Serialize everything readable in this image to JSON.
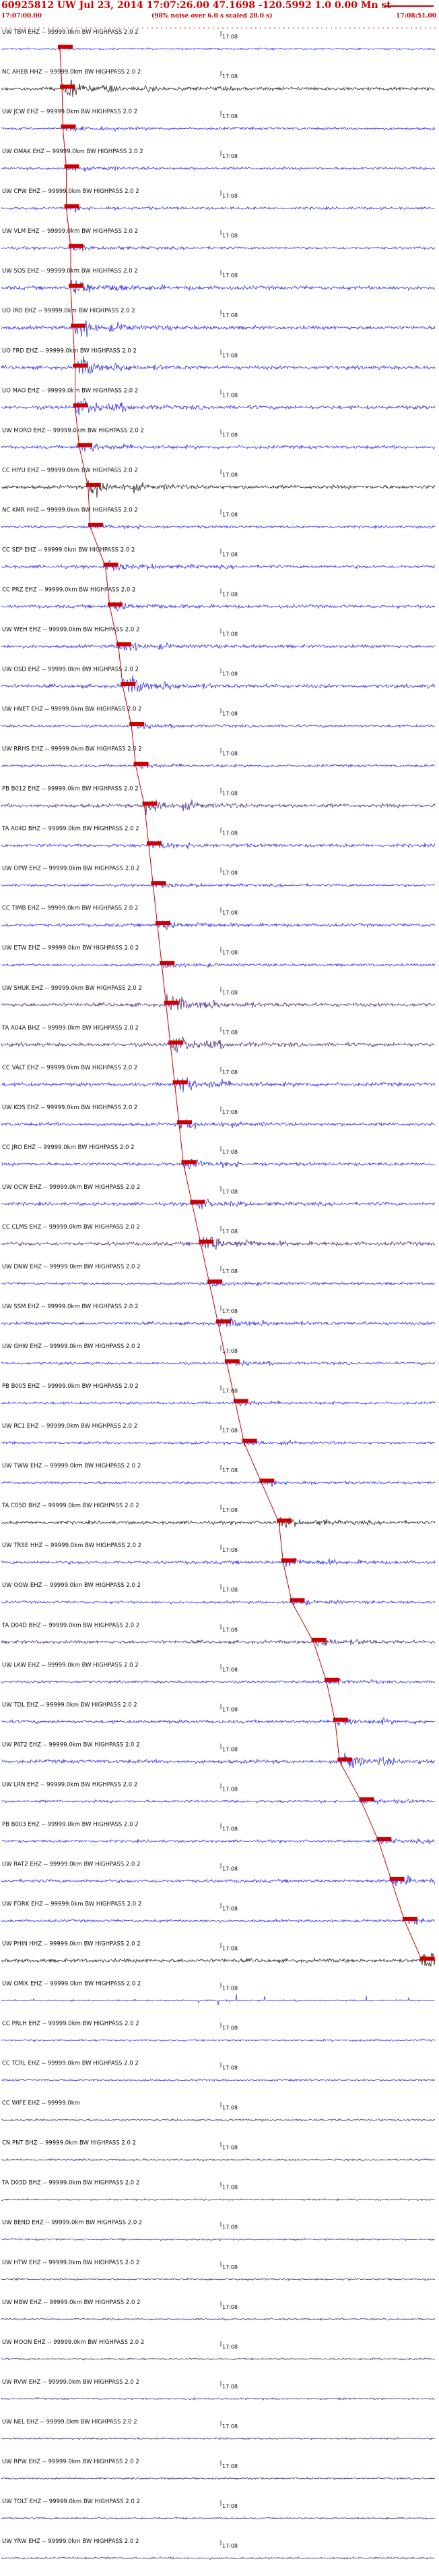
{
  "header": {
    "title": "60925812 UW Jul 23, 2014 17:07:26.00   47.1698 -120.5992  1.0 0.00 Mn st",
    "start_time": "17:07:00.00",
    "note": "(98% noise over 6.0 s scaled 20.0 s)",
    "end_time": "17:08:51.00"
  },
  "chart_data": {
    "type": "line",
    "title": "60925812 UW Jul 23, 2014 17:07:26.00   47.1698 -120.5992  1.0 0.00 Mn st",
    "minute_label": "17:08",
    "pick_color": "#cc0000",
    "trace_colors": [
      "#1a1aee",
      "#111111",
      "#3a1a7a"
    ],
    "tick_color": "#cc0000",
    "traces": [
      {
        "label": "UW TBM EHZ -- 99999.0km BW  HIGHPASS  2.0  2",
        "color": "blue",
        "pick_frac": 0.135,
        "burst": "none"
      },
      {
        "label": "NC AHEB HHZ -- 99999.0km BW  HIGHPASS  2.0  2",
        "color": "black",
        "pick_frac": 0.14,
        "burst": "strong"
      },
      {
        "label": "UW JCW EHZ -- 99999.0km BW  HIGHPASS  2.0  2",
        "color": "blue",
        "pick_frac": 0.142,
        "burst": "weak"
      },
      {
        "label": "UW OMAK EHZ -- 99999.0km BW  HIGHPASS  2.0  2",
        "color": "blue",
        "pick_frac": 0.15,
        "burst": "weak"
      },
      {
        "label": "UW CPW EHZ -- 99999.0km BW  HIGHPASS  2.0  2",
        "color": "blue",
        "pick_frac": 0.15,
        "burst": "weak"
      },
      {
        "label": "UW VLM EHZ -- 99999.0km BW  HIGHPASS  2.0  2",
        "color": "blue",
        "pick_frac": 0.16,
        "burst": "weak"
      },
      {
        "label": "UW SOS EHZ -- 99999.0km BW  HIGHPASS  2.0  2",
        "color": "blue",
        "pick_frac": 0.16,
        "burst": "strong"
      },
      {
        "label": "UO IRO EHZ -- 99999.0km BW  HIGHPASS  2.0  2",
        "color": "blue",
        "pick_frac": 0.165,
        "burst": "strong"
      },
      {
        "label": "UO FRD EHZ -- 99999.0km BW  HIGHPASS  2.0  2",
        "color": "blue",
        "pick_frac": 0.17,
        "burst": "strong"
      },
      {
        "label": "UO MAO EHZ -- 99999.0km BW  HIGHPASS  2.0  2",
        "color": "blue",
        "pick_frac": 0.17,
        "burst": "strong"
      },
      {
        "label": "UW MORO EHZ -- 99999.0km BW  HIGHPASS  2.0  2",
        "color": "blue",
        "pick_frac": 0.18,
        "burst": "medium"
      },
      {
        "label": "CC HIYU EHZ -- 99999.0km BW  HIGHPASS  2.0  2",
        "color": "black",
        "pick_frac": 0.2,
        "burst": "strong"
      },
      {
        "label": "NC KMR HHZ -- 99999.0km BW  HIGHPASS  2.0  2",
        "color": "blue",
        "pick_frac": 0.205,
        "burst": "weak"
      },
      {
        "label": "CC SEP EHZ -- 99999.0km BW  HIGHPASS  2.0  2",
        "color": "blue",
        "pick_frac": 0.24,
        "burst": "medium"
      },
      {
        "label": "CC PRZ EHZ -- 99999.0km BW  HIGHPASS  2.0  2",
        "color": "blue",
        "pick_frac": 0.25,
        "burst": "medium"
      },
      {
        "label": "UW WEH EHZ -- 99999.0km BW  HIGHPASS  2.0  2",
        "color": "blue",
        "pick_frac": 0.27,
        "burst": "medium"
      },
      {
        "label": "UW OSD EHZ -- 99999.0km BW  HIGHPASS  2.0  2",
        "color": "blue",
        "pick_frac": 0.28,
        "burst": "strong"
      },
      {
        "label": "UW HNET EHZ -- 99999.0km BW  HIGHPASS  2.0  2",
        "color": "blue",
        "pick_frac": 0.3,
        "burst": "weak"
      },
      {
        "label": "UW RRHS EHZ -- 99999.0km BW  HIGHPASS  2.0  2",
        "color": "blue",
        "pick_frac": 0.31,
        "burst": "weak"
      },
      {
        "label": "PB B012 EHZ -- 99999.0km BW  HIGHPASS  2.0  2",
        "color": "purple",
        "pick_frac": 0.33,
        "burst": "strong"
      },
      {
        "label": "TA A04D BHZ -- 99999.0km BW  HIGHPASS  2.0  2",
        "color": "blue",
        "pick_frac": 0.34,
        "burst": "medium"
      },
      {
        "label": "UW OPW EHZ -- 99999.0km BW  HIGHPASS  2.0  2",
        "color": "blue",
        "pick_frac": 0.35,
        "burst": "weak"
      },
      {
        "label": "CC TIMB EHZ -- 99999.0km BW  HIGHPASS  2.0  2",
        "color": "blue",
        "pick_frac": 0.36,
        "burst": "medium"
      },
      {
        "label": "UW ETW EHZ -- 99999.0km BW  HIGHPASS  2.0  2",
        "color": "blue",
        "pick_frac": 0.37,
        "burst": "weak"
      },
      {
        "label": "UW SHUK EHZ -- 99999.0km BW  HIGHPASS  2.0  2",
        "color": "purple",
        "pick_frac": 0.38,
        "burst": "strong"
      },
      {
        "label": "TA A04A BHZ -- 99999.0km BW  HIGHPASS  2.0  2",
        "color": "purple",
        "pick_frac": 0.39,
        "burst": "strong"
      },
      {
        "label": "CC VALT EHZ -- 99999.0km BW  HIGHPASS  2.0  2",
        "color": "blue",
        "pick_frac": 0.4,
        "burst": "strong"
      },
      {
        "label": "UW KOS EHZ -- 99999.0km BW  HIGHPASS  2.0  2",
        "color": "blue",
        "pick_frac": 0.41,
        "burst": "medium"
      },
      {
        "label": "CC JRO EHZ -- 99999.0km BW  HIGHPASS  2.0  2",
        "color": "blue",
        "pick_frac": 0.42,
        "burst": "medium"
      },
      {
        "label": "UW OCW EHZ -- 99999.0km BW  HIGHPASS  2.0  2",
        "color": "blue",
        "pick_frac": 0.44,
        "burst": "medium"
      },
      {
        "label": "CC CLMS EHZ -- 99999.0km BW  HIGHPASS  2.0  2",
        "color": "purple",
        "pick_frac": 0.46,
        "burst": "strong"
      },
      {
        "label": "UW DNW EHZ -- 99999.0km BW  HIGHPASS  2.0  2",
        "color": "blue",
        "pick_frac": 0.48,
        "burst": "weak"
      },
      {
        "label": "UW SSM EHZ -- 99999.0km BW  HIGHPASS  2.0  2",
        "color": "blue",
        "pick_frac": 0.5,
        "burst": "medium"
      },
      {
        "label": "UW GHW EHZ -- 99999.0km BW  HIGHPASS  2.0  2",
        "color": "blue",
        "pick_frac": 0.52,
        "burst": "weak"
      },
      {
        "label": "PB B005 EHZ -- 99999.0km BW  HIGHPASS  2.0  2",
        "color": "blue",
        "pick_frac": 0.54,
        "burst": "weak"
      },
      {
        "label": "UW RC1 EHZ -- 99999.0km BW  HIGHPASS  2.0  2",
        "color": "blue",
        "pick_frac": 0.56,
        "burst": "weak"
      },
      {
        "label": "UW TWW EHZ -- 99999.0km BW  HIGHPASS  2.0  2",
        "color": "blue",
        "pick_frac": 0.6,
        "burst": "weak"
      },
      {
        "label": "TA C05D BHZ -- 99999.0km BW  HIGHPASS  2.0  2",
        "color": "black",
        "pick_frac": 0.64,
        "burst": "medium"
      },
      {
        "label": "UW TRSE HHZ -- 99999.0km BW  HIGHPASS  2.0  2",
        "color": "blue",
        "pick_frac": 0.65,
        "burst": "medium"
      },
      {
        "label": "UW OOW EHZ -- 99999.0km BW  HIGHPASS  2.0  2",
        "color": "blue",
        "pick_frac": 0.67,
        "burst": "weak"
      },
      {
        "label": "TA D04D BHZ -- 99999.0km BW  HIGHPASS  2.0  2",
        "color": "purple",
        "pick_frac": 0.72,
        "burst": "medium"
      },
      {
        "label": "UW LKW EHZ -- 99999.0km BW  HIGHPASS  2.0  2",
        "color": "blue",
        "pick_frac": 0.75,
        "burst": "weak"
      },
      {
        "label": "UW TDL EHZ -- 99999.0km BW  HIGHPASS  2.0  2",
        "color": "blue",
        "pick_frac": 0.77,
        "burst": "medium"
      },
      {
        "label": "UW PAT2 EHZ -- 99999.0km BW  HIGHPASS  2.0  2",
        "color": "blue",
        "pick_frac": 0.78,
        "burst": "strong"
      },
      {
        "label": "UW LRN EHZ -- 99999.0km BW  HIGHPASS  2.0  2",
        "color": "blue",
        "pick_frac": 0.83,
        "burst": "weak"
      },
      {
        "label": "PB B003 EHZ -- 99999.0km BW  HIGHPASS  2.0  2",
        "color": "blue",
        "pick_frac": 0.87,
        "burst": "weak"
      },
      {
        "label": "UW RAT2 EHZ -- 99999.0km BW  HIGHPASS  2.0  2",
        "color": "blue",
        "pick_frac": 0.9,
        "burst": "medium"
      },
      {
        "label": "UW FORK EHZ -- 99999.0km BW  HIGHPASS  2.0  2",
        "color": "blue",
        "pick_frac": 0.93,
        "burst": "weak"
      },
      {
        "label": "UW PHIN HHZ -- 99999.0km BW  HIGHPASS  2.0  2",
        "color": "black",
        "pick_frac": 0.97,
        "burst": "strong"
      },
      {
        "label": "UW OMIK EHZ -- 99999.0km BW  HIGHPASS  2.0  2",
        "color": "blue",
        "pick_frac": null,
        "burst": "spiky"
      },
      {
        "label": "CC PRLH EHZ -- 99999.0km BW  HIGHPASS  2.0  2",
        "color": "blue",
        "pick_frac": null,
        "burst": "none"
      },
      {
        "label": "CC TCRL EHZ -- 99999.0km BW  HIGHPASS  2.0  2",
        "color": "blue",
        "pick_frac": null,
        "burst": "none"
      },
      {
        "label": "CC WIFE EHZ -- 99999.0km",
        "color": "purple",
        "pick_frac": null,
        "burst": "none"
      },
      {
        "label": "CN PNT BHZ -- 99999.0km BW  HIGHPASS  2.0  2",
        "color": "purple",
        "pick_frac": null,
        "burst": "none"
      },
      {
        "label": "TA D03D BHZ -- 99999.0km BW  HIGHPASS  2.0  2",
        "color": "purple",
        "pick_frac": null,
        "burst": "none"
      },
      {
        "label": "UW BEND EHZ -- 99999.0km BW  HIGHPASS  2.0  2",
        "color": "purple",
        "pick_frac": null,
        "burst": "none"
      },
      {
        "label": "UW HTW EHZ -- 99999.0km BW  HIGHPASS  2.0  2",
        "color": "purple",
        "pick_frac": null,
        "burst": "none"
      },
      {
        "label": "UW MBW EHZ -- 99999.0km BW  HIGHPASS  2.0  2",
        "color": "purple",
        "pick_frac": null,
        "burst": "none"
      },
      {
        "label": "UW MOON EHZ -- 99999.0km BW  HIGHPASS  2.0  2",
        "color": "purple",
        "pick_frac": null,
        "burst": "none"
      },
      {
        "label": "UW RVW EHZ -- 99999.0km BW  HIGHPASS  2.0  2",
        "color": "purple",
        "pick_frac": null,
        "burst": "none"
      },
      {
        "label": "UW NEL EHZ -- 99999.0km BW  HIGHPASS  2.0  2",
        "color": "purple",
        "pick_frac": null,
        "burst": "none"
      },
      {
        "label": "UW RPW EHZ -- 99999.0km BW  HIGHPASS  2.0  2",
        "color": "purple",
        "pick_frac": null,
        "burst": "none"
      },
      {
        "label": "UW TOLT EHZ -- 99999.0km BW  HIGHPASS  2.0  2",
        "color": "purple",
        "pick_frac": null,
        "burst": "none"
      },
      {
        "label": "UW YRW EHZ -- 99999.0km BW  HIGHPASS  2.0  2",
        "color": "purple",
        "pick_frac": null,
        "burst": "none"
      }
    ]
  }
}
